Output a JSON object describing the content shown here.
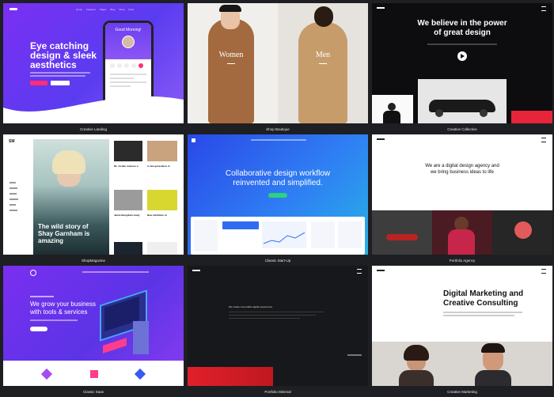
{
  "tiles": [
    {
      "caption": "Creative Landing",
      "headline_l1": "Eye catching",
      "headline_l2": "design & sleek",
      "headline_l3": "aesthetics",
      "phone_greeting": "Good Morning!",
      "nav": [
        "Home",
        "Features",
        "Pages",
        "Blog",
        "Shop",
        "Docs"
      ]
    },
    {
      "caption": "Shop Boutique",
      "left_label": "Women",
      "right_label": "Men"
    },
    {
      "caption": "Creative Collective",
      "headline_l1": "We believe in the power",
      "headline_l2": "of great design"
    },
    {
      "caption": "ShopMagazine",
      "logo": "SM",
      "hero_l1": "The wild story of",
      "hero_l2": "Shay Garnham is",
      "hero_l3": "amazing",
      "articles": [
        "Mr. Jordan releases a",
        "A new generation of",
        "Jamie Bengdiski ready",
        "New exhibition at"
      ]
    },
    {
      "caption": "Classic Start-Up",
      "headline_l1": "Collaborative design workflow",
      "headline_l2": "reinvented and simplified."
    },
    {
      "caption": "Portfolio Agency",
      "headline_l1": "We are a digital design agency and",
      "headline_l2": "we bring business ideas to life"
    },
    {
      "caption": "Classic Saas",
      "headline_l1": "We grow your business",
      "headline_l2": "with tools & services"
    },
    {
      "caption": "Portfolio Minimal",
      "text_line": "We create memorable digital experiences"
    },
    {
      "caption": "Creative Marketing",
      "headline_l1": "Digital Marketing and",
      "headline_l2": "Creative Consulting"
    }
  ],
  "colors": {
    "page_bg": "#1e1f22",
    "purple": "#6a2bd9",
    "blue": "#2f6df0",
    "dark": "#131416",
    "accent_red": "#e8243a"
  }
}
